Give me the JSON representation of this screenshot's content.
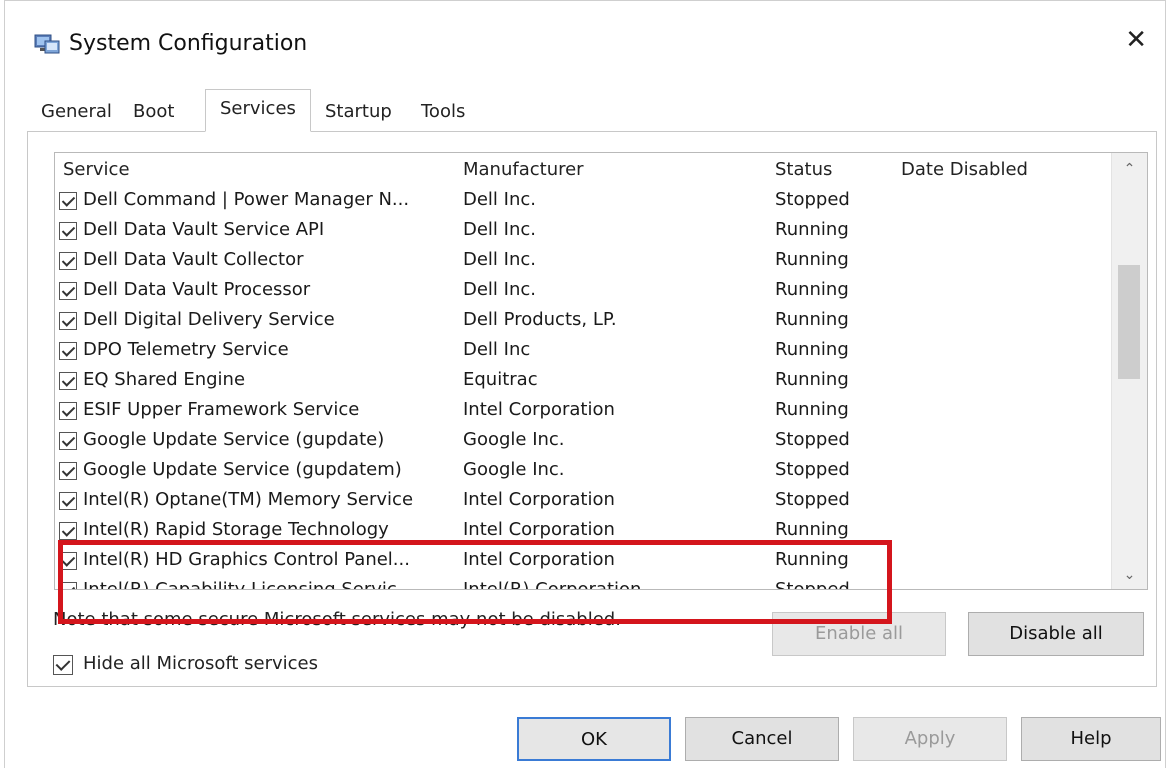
{
  "window": {
    "title": "System Configuration",
    "close_glyph": "✕"
  },
  "tabs": [
    "General",
    "Boot",
    "Services",
    "Startup",
    "Tools"
  ],
  "active_tab": "Services",
  "columns": {
    "service": "Service",
    "manufacturer": "Manufacturer",
    "status": "Status",
    "date_disabled": "Date Disabled"
  },
  "rows": [
    {
      "service": "Dell Command | Power Manager N...",
      "manufacturer": "Dell Inc.",
      "status": "Stopped",
      "checked": true
    },
    {
      "service": "Dell Data Vault Service API",
      "manufacturer": "Dell Inc.",
      "status": "Running",
      "checked": true
    },
    {
      "service": "Dell Data Vault Collector",
      "manufacturer": "Dell Inc.",
      "status": "Running",
      "checked": true
    },
    {
      "service": "Dell Data Vault Processor",
      "manufacturer": "Dell Inc.",
      "status": "Running",
      "checked": true
    },
    {
      "service": "Dell Digital Delivery Service",
      "manufacturer": "Dell Products, LP.",
      "status": "Running",
      "checked": true
    },
    {
      "service": "DPO Telemetry Service",
      "manufacturer": "Dell Inc",
      "status": "Running",
      "checked": true
    },
    {
      "service": "EQ Shared Engine",
      "manufacturer": "Equitrac",
      "status": "Running",
      "checked": true
    },
    {
      "service": "ESIF Upper Framework Service",
      "manufacturer": "Intel Corporation",
      "status": "Running",
      "checked": true
    },
    {
      "service": "Google Update Service (gupdate)",
      "manufacturer": "Google Inc.",
      "status": "Stopped",
      "checked": true
    },
    {
      "service": "Google Update Service (gupdatem)",
      "manufacturer": "Google Inc.",
      "status": "Stopped",
      "checked": true
    },
    {
      "service": "Intel(R) Optane(TM) Memory Service",
      "manufacturer": "Intel Corporation",
      "status": "Stopped",
      "checked": true
    },
    {
      "service": "Intel(R) Rapid Storage Technology",
      "manufacturer": "Intel Corporation",
      "status": "Running",
      "checked": true
    },
    {
      "service": "Intel(R) HD Graphics Control Panel...",
      "manufacturer": "Intel Corporation",
      "status": "Running",
      "checked": true
    },
    {
      "service": "Intel(R) Capability Licensing Servic...",
      "manufacturer": "Intel(R) Corporation",
      "status": "Stopped",
      "checked": true
    }
  ],
  "note": "Note that some secure Microsoft services may not be disabled.",
  "hide_microsoft": {
    "label": "Hide all Microsoft services",
    "checked": true
  },
  "buttons": {
    "enable_all": "Enable all",
    "disable_all": "Disable all",
    "ok": "OK",
    "cancel": "Cancel",
    "apply": "Apply",
    "help": "Help"
  },
  "colors": {
    "highlight": "#d4151c",
    "accent": "#3a7bd5"
  },
  "icons": {
    "app": "system-configuration-icon",
    "close": "close-icon",
    "scroll_up": "chevron-up-icon",
    "scroll_down": "chevron-down-icon"
  }
}
